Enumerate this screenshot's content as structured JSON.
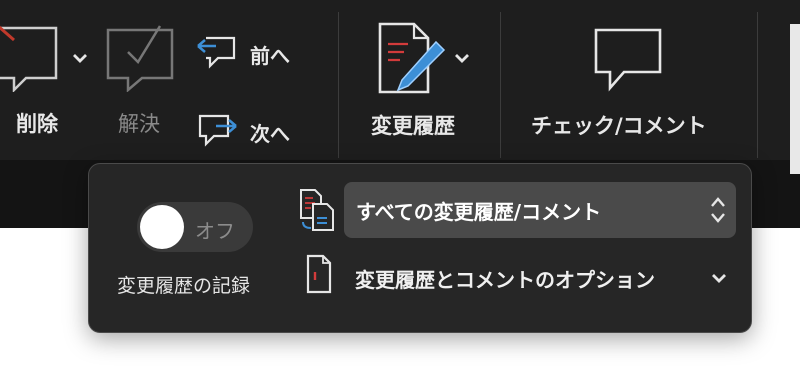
{
  "ribbon": {
    "delete_label": "削除",
    "resolve_label": "解決",
    "prev_label": "前へ",
    "next_label": "次へ",
    "track_changes_label": "変更履歴",
    "check_comments_label": "チェック/コメント"
  },
  "popup": {
    "toggle_state": "オフ",
    "track_label": "変更履歴の記録",
    "markup_select_value": "すべての変更履歴/コメント",
    "options_label": "変更履歴とコメントのオプション"
  },
  "colors": {
    "ribbon_bg": "#1e1e1e",
    "popup_bg": "#262626",
    "accent_blue": "#3d8fd6",
    "accent_red": "#d23b3b"
  },
  "icons": [
    "delete-comment-icon",
    "resolve-comment-icon",
    "previous-comment-icon",
    "next-comment-icon",
    "track-changes-icon",
    "check-comment-icon",
    "markup-display-icon",
    "options-document-icon",
    "chevron-down-icon",
    "up-down-chevron-icon"
  ]
}
